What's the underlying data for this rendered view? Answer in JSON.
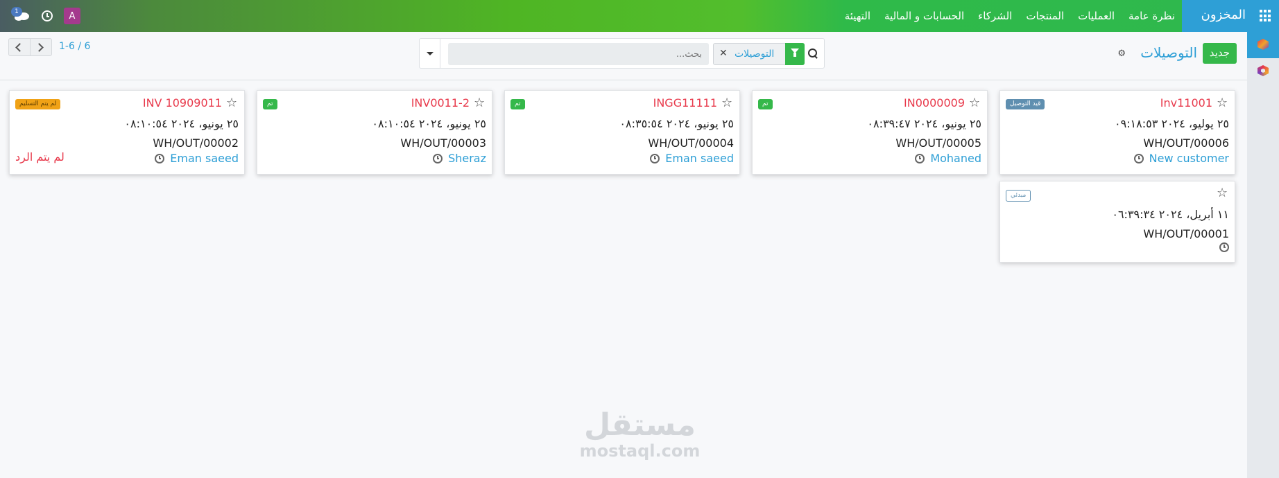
{
  "topbar": {
    "app_title": "المخزون",
    "menu": [
      "نظرة عامة",
      "العمليات",
      "المنتجات",
      "الشركاء",
      "الحسابات و المالية",
      "التهيئة"
    ],
    "avatar_letter": "A",
    "chat_count": "1"
  },
  "control": {
    "new_button": "جديد",
    "page_title": "التوصيلات",
    "search_placeholder": "بحث...",
    "facet_label": "التوصيلات",
    "pager": "1-6 / 6"
  },
  "cards": [
    {
      "ref": "Inv11001",
      "badge": "قيد التوصيل",
      "badge_color": "#5f8fb0",
      "date": "٢٥ يوليو، ٢٠٢٤ ٠٩:١٨:٥٣",
      "code": "WH/OUT/00006",
      "partner": "New customer"
    },
    {
      "ref": "IN0000009",
      "badge": "تم",
      "badge_color": "#35b84a",
      "date": "٢٥ يونيو، ٢٠٢٤ ٠٨:٣٩:٤٧",
      "code": "WH/OUT/00005",
      "partner": "Mohaned"
    },
    {
      "ref": "INGG11111",
      "badge": "تم",
      "badge_color": "#35b84a",
      "date": "٢٥ يونيو، ٢٠٢٤ ٠٨:٣٥:٥٤",
      "code": "WH/OUT/00004",
      "partner": "Eman saeed"
    },
    {
      "ref": "INV0011-2",
      "badge": "تم",
      "badge_color": "#35b84a",
      "date": "٢٥ يونيو، ٢٠٢٤ ٠٨:١٠:٥٤",
      "code": "WH/OUT/00003",
      "partner": "Sheraz"
    },
    {
      "ref": "INV 10909011",
      "badge": "لم يتم التسليم",
      "badge_color": "#f0a216",
      "date": "٢٥ يونيو، ٢٠٢٤ ٠٨:١٠:٥٤",
      "code": "WH/OUT/00002",
      "partner": "Eman saeed",
      "note": "لم يتم الرد"
    },
    {
      "ref": "",
      "badge": "مبدئي",
      "badge_color": "#5f8fb0",
      "date": "١١ أبريل، ٢٠٢٤ ٠٦:٣٩:٣٤",
      "code": "WH/OUT/00001",
      "partner": ""
    }
  ],
  "watermark": {
    "ar": "مستقل",
    "en": "mostaql.com"
  }
}
